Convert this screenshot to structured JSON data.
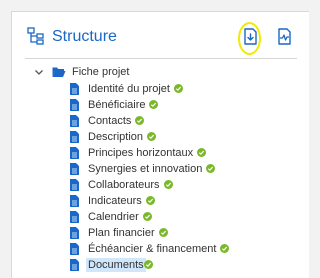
{
  "panel": {
    "title": "Structure",
    "toolbar": {
      "download_icon": "download-file-icon",
      "history_icon": "file-activity-icon",
      "highlight_color": "#f2ea00"
    }
  },
  "tree": {
    "root": {
      "label": "Fiche projet",
      "expanded": true
    },
    "items": [
      {
        "label": "Identité du projet",
        "complete": true
      },
      {
        "label": "Bénéficiaire",
        "complete": true
      },
      {
        "label": "Contacts",
        "complete": true
      },
      {
        "label": "Description",
        "complete": true
      },
      {
        "label": "Principes horizontaux",
        "complete": true
      },
      {
        "label": "Synergies et innovation",
        "complete": true
      },
      {
        "label": "Collaborateurs",
        "complete": true
      },
      {
        "label": "Indicateurs",
        "complete": true
      },
      {
        "label": "Calendrier",
        "complete": true
      },
      {
        "label": "Plan financier",
        "complete": true
      },
      {
        "label": "Échéancier & financement",
        "complete": true
      },
      {
        "label": "Documents",
        "complete": true,
        "selected": true
      }
    ]
  },
  "colors": {
    "accent": "#1a67c7",
    "check": "#7ab829",
    "selected_bg": "#cfe6fb"
  }
}
